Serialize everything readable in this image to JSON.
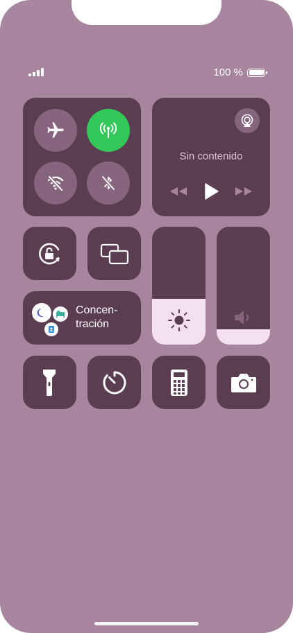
{
  "status": {
    "battery_text": "100 %",
    "battery_level": 1.0,
    "signal_bars": 4
  },
  "connectivity": {
    "airplane": {
      "icon": "airplane-icon",
      "active": false
    },
    "cellular": {
      "icon": "cellular-antenna-icon",
      "active": true
    },
    "wifi": {
      "icon": "wifi-off-icon",
      "active": false
    },
    "bluetooth": {
      "icon": "bluetooth-off-icon",
      "active": false
    }
  },
  "media": {
    "title": "Sin contenido",
    "airplay_icon": "airplay-icon",
    "rewind_icon": "rewind-icon",
    "play_icon": "play-icon",
    "forward_icon": "fast-forward-icon"
  },
  "orientation_lock": {
    "icon": "orientation-lock-icon"
  },
  "screen_mirroring": {
    "icon": "screen-mirroring-icon"
  },
  "brightness": {
    "icon": "sun-icon",
    "level": 0.39
  },
  "volume": {
    "icon": "speaker-icon",
    "level": 0.13
  },
  "focus": {
    "label": "Concen-\ntración",
    "icons": [
      "moon-icon",
      "bed-icon",
      "id-badge-icon"
    ]
  },
  "quick_actions": [
    {
      "name": "flashlight",
      "icon": "flashlight-icon"
    },
    {
      "name": "timer",
      "icon": "timer-icon"
    },
    {
      "name": "calculator",
      "icon": "calculator-icon"
    },
    {
      "name": "camera",
      "icon": "camera-icon"
    }
  ],
  "colors": {
    "background": "#a7859e",
    "tile": "#5b3d52",
    "button_inactive": "#86647d",
    "cellular_active": "#34c759",
    "slider_fill": "#f5e0f0",
    "focus_moon": "#5856d6",
    "focus_bed": "#3ab0a0",
    "focus_badge": "#2d8fd6"
  }
}
